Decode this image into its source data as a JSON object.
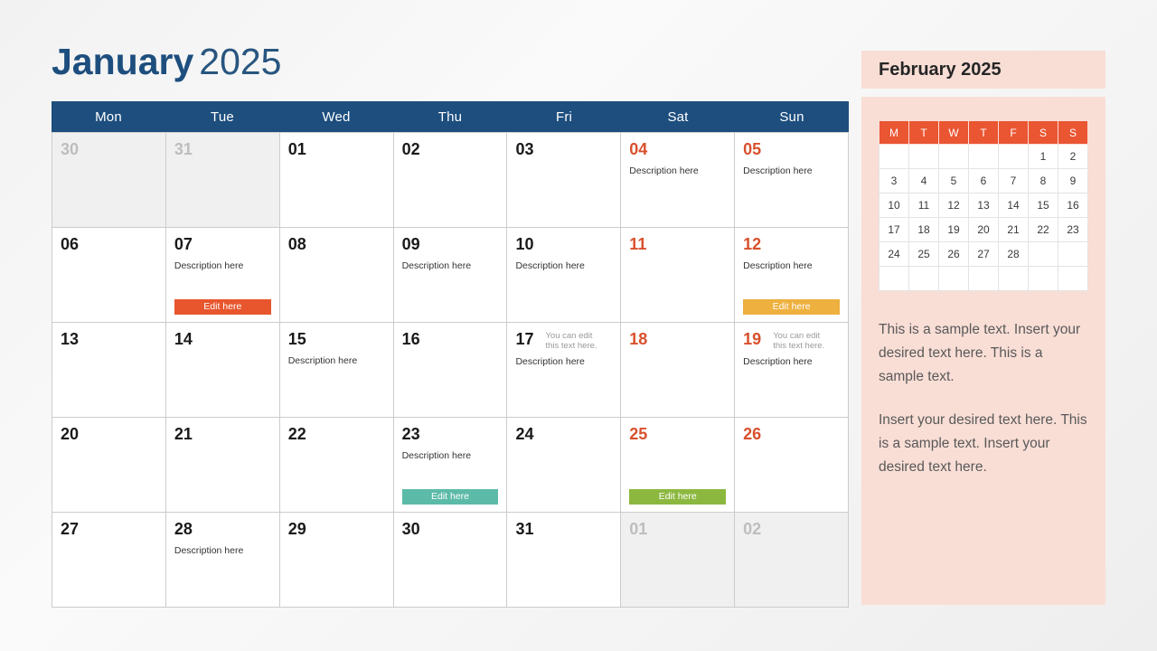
{
  "title": {
    "month": "January",
    "year": "2025"
  },
  "calendar": {
    "day_headers": [
      "Mon",
      "Tue",
      "Wed",
      "Thu",
      "Fri",
      "Sat",
      "Sun"
    ],
    "weeks": [
      [
        {
          "num": "30",
          "muted": true
        },
        {
          "num": "31",
          "muted": true
        },
        {
          "num": "01"
        },
        {
          "num": "02"
        },
        {
          "num": "03"
        },
        {
          "num": "04",
          "weekend": true,
          "desc": "Description here"
        },
        {
          "num": "05",
          "weekend": true,
          "desc": "Description here"
        }
      ],
      [
        {
          "num": "06"
        },
        {
          "num": "07",
          "desc": "Description here",
          "button": {
            "label": "Edit here",
            "color": "#e8562d"
          }
        },
        {
          "num": "08"
        },
        {
          "num": "09",
          "desc": "Description here"
        },
        {
          "num": "10",
          "desc": "Description here"
        },
        {
          "num": "11",
          "weekend": true
        },
        {
          "num": "12",
          "weekend": true,
          "desc": "Description here",
          "button": {
            "label": "Edit here",
            "color": "#eeb03f"
          }
        }
      ],
      [
        {
          "num": "13"
        },
        {
          "num": "14"
        },
        {
          "num": "15",
          "desc": "Description here"
        },
        {
          "num": "16"
        },
        {
          "num": "17",
          "note": "You can edit this text here.",
          "desc": "Description here"
        },
        {
          "num": "18",
          "weekend": true
        },
        {
          "num": "19",
          "weekend": true,
          "note": "You can edit this text here.",
          "desc": "Description here"
        }
      ],
      [
        {
          "num": "20"
        },
        {
          "num": "21"
        },
        {
          "num": "22"
        },
        {
          "num": "23",
          "desc": "Description here",
          "button": {
            "label": "Edit here",
            "color": "#5cbaa8"
          }
        },
        {
          "num": "24"
        },
        {
          "num": "25",
          "weekend": true,
          "button": {
            "label": "Edit here",
            "color": "#8cb83f"
          }
        },
        {
          "num": "26",
          "weekend": true
        }
      ],
      [
        {
          "num": "27"
        },
        {
          "num": "28",
          "desc": "Description here"
        },
        {
          "num": "29"
        },
        {
          "num": "30"
        },
        {
          "num": "31"
        },
        {
          "num": "01",
          "muted": true
        },
        {
          "num": "02",
          "muted": true
        }
      ]
    ]
  },
  "side": {
    "title": "February 2025",
    "mini_day_headers": [
      "M",
      "T",
      "W",
      "T",
      "F",
      "S",
      "S"
    ],
    "mini_weeks": [
      [
        "",
        "",
        "",
        "",
        "",
        "1",
        "2"
      ],
      [
        "3",
        "4",
        "5",
        "6",
        "7",
        "8",
        "9"
      ],
      [
        "10",
        "11",
        "12",
        "13",
        "14",
        "15",
        "16"
      ],
      [
        "17",
        "18",
        "19",
        "20",
        "21",
        "22",
        "23"
      ],
      [
        "24",
        "25",
        "26",
        "27",
        "28",
        "",
        ""
      ],
      [
        "",
        "",
        "",
        "",
        "",
        "",
        ""
      ]
    ],
    "paragraphs": [
      "This is a sample text. Insert your desired text here. This is a sample text.",
      "Insert your desired text here. This is a sample text. Insert your desired text here."
    ]
  },
  "colors": {
    "header_blue": "#1d4e7e",
    "weekend_red": "#d8502c",
    "panel_pink": "#f9ded6",
    "mini_header_orange": "#ea5532"
  }
}
